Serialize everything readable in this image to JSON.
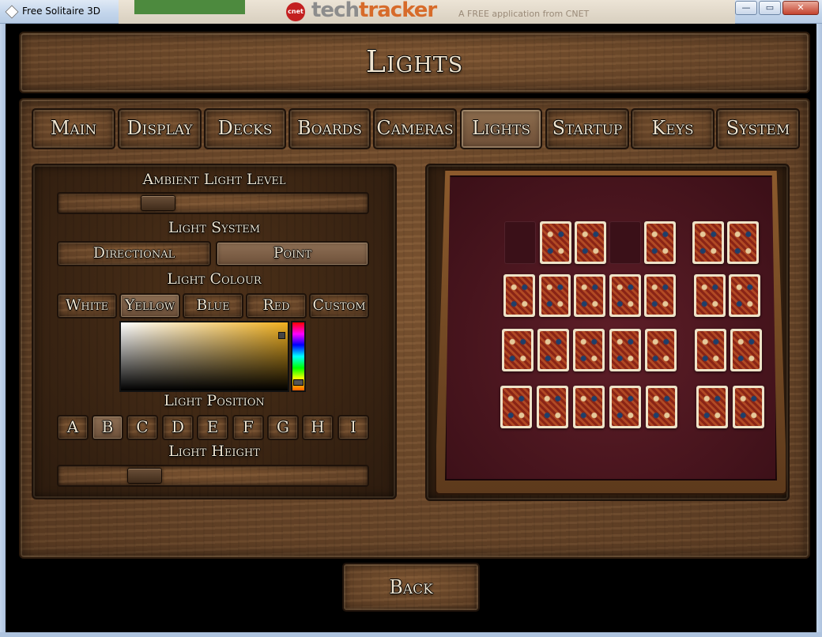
{
  "window": {
    "title": "Free Solitaire 3D",
    "controls": {
      "minimize": "—",
      "maximize": "▭",
      "close": "✕"
    }
  },
  "ad_banner": {
    "badge": "cnet",
    "brand_prefix": "tech",
    "brand_suffix": "tracker",
    "tagline": "A FREE application from CNET"
  },
  "page_title": "Lights",
  "tabs": [
    {
      "label": "Main",
      "active": false
    },
    {
      "label": "Display",
      "active": false
    },
    {
      "label": "Decks",
      "active": false
    },
    {
      "label": "Boards",
      "active": false
    },
    {
      "label": "Cameras",
      "active": false
    },
    {
      "label": "Lights",
      "active": true
    },
    {
      "label": "Startup",
      "active": false
    },
    {
      "label": "Keys",
      "active": false
    },
    {
      "label": "System",
      "active": false
    }
  ],
  "settings": {
    "ambient": {
      "label": "Ambient Light Level",
      "level": 0.3
    },
    "system": {
      "label": "Light System",
      "options": [
        "Directional",
        "Point"
      ],
      "selected": "Point"
    },
    "colour": {
      "label": "Light Colour",
      "options": [
        "White",
        "Yellow",
        "Blue",
        "Red",
        "Custom"
      ],
      "selected": "Yellow",
      "picked_color": "#f0b020"
    },
    "position": {
      "label": "Light Position",
      "options": [
        "A",
        "B",
        "C",
        "D",
        "E",
        "F",
        "G",
        "H",
        "I"
      ],
      "selected": "B"
    },
    "height": {
      "label": "Light Height",
      "level": 0.25
    }
  },
  "preview": {
    "felt_color": "#5e1e28",
    "card_back": "red-pattern-card-back"
  },
  "back_button": "Back"
}
